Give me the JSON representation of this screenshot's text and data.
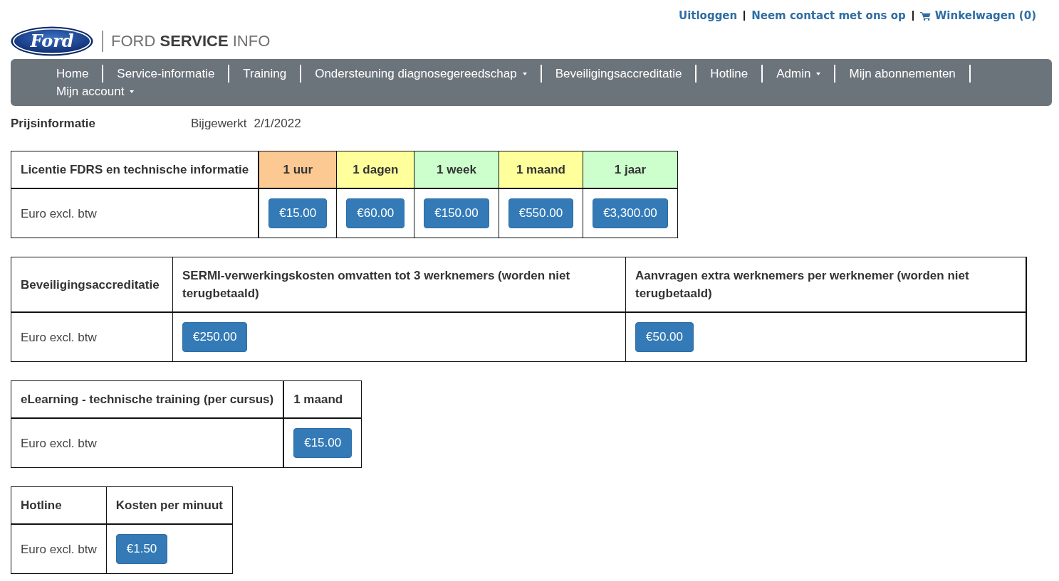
{
  "top_links": [
    {
      "label": "Uitloggen",
      "kind": "plain"
    },
    {
      "label": "Neem contact met ons op",
      "kind": "plain"
    },
    {
      "label": "Winkelwagen (0)",
      "kind": "cart"
    }
  ],
  "logo": {
    "emblem_text": "Ford",
    "wordmark": "FORD **SERVICE** INFO"
  },
  "nav": {
    "items": [
      {
        "label": "Home",
        "dropdown": false
      },
      {
        "label": "Service-informatie",
        "dropdown": false
      },
      {
        "label": "Training",
        "dropdown": false
      },
      {
        "label": "Ondersteuning diagnosegereedschap",
        "dropdown": true
      },
      {
        "label": "Beveiligingsaccreditatie",
        "dropdown": false
      },
      {
        "label": "Hotline",
        "dropdown": false
      },
      {
        "label": "Admin",
        "dropdown": true
      },
      {
        "label": "Mijn abonnementen",
        "dropdown": false
      },
      {
        "label": "Mijn account",
        "dropdown": true
      }
    ]
  },
  "page_header": {
    "title": "Prijsinformatie",
    "updated_label": "Bijgewerkt",
    "updated_date": "2/1/2022"
  },
  "price_tables": [
    {
      "kind": "tiered",
      "columns": [
        {
          "label": "Licentie FDRS en technische informatie"
        },
        {
          "label": "1 uur",
          "color": "#fcc993"
        },
        {
          "label": "1 dagen",
          "color": "#ffff9c"
        },
        {
          "label": "1 week",
          "color": "#ccffcc"
        },
        {
          "label": "1 maand",
          "color": "#ffff9c"
        },
        {
          "label": "1 jaar",
          "color": "#ccffcc"
        }
      ],
      "rows": [
        {
          "label": "Euro excl. btw",
          "prices": [
            "€15.00",
            "€60.00",
            "€150.00",
            "€550.00",
            "€3,300.00"
          ]
        }
      ]
    },
    {
      "kind": "plain",
      "columns": [
        {
          "label": "Beveiligingsaccreditatie"
        },
        {
          "label": "SERMI-verwerkingskosten omvatten tot 3 werknemers (worden niet terugbetaald)"
        },
        {
          "label": "Aanvragen extra werknemers per werknemer (worden niet terugbetaald)"
        }
      ],
      "rows": [
        {
          "label": "Euro excl. btw",
          "prices": [
            "€250.00",
            "€50.00"
          ]
        }
      ]
    },
    {
      "kind": "plain",
      "columns": [
        {
          "label": "eLearning - technische training (per cursus)"
        },
        {
          "label": "1 maand"
        }
      ],
      "rows": [
        {
          "label": "Euro excl. btw",
          "prices": [
            "€15.00"
          ]
        }
      ]
    },
    {
      "kind": "plain",
      "columns": [
        {
          "label": "Hotline"
        },
        {
          "label": "Kosten per minuut"
        }
      ],
      "rows": [
        {
          "label": "Euro excl. btw",
          "prices": [
            "€1.50"
          ]
        }
      ]
    }
  ]
}
